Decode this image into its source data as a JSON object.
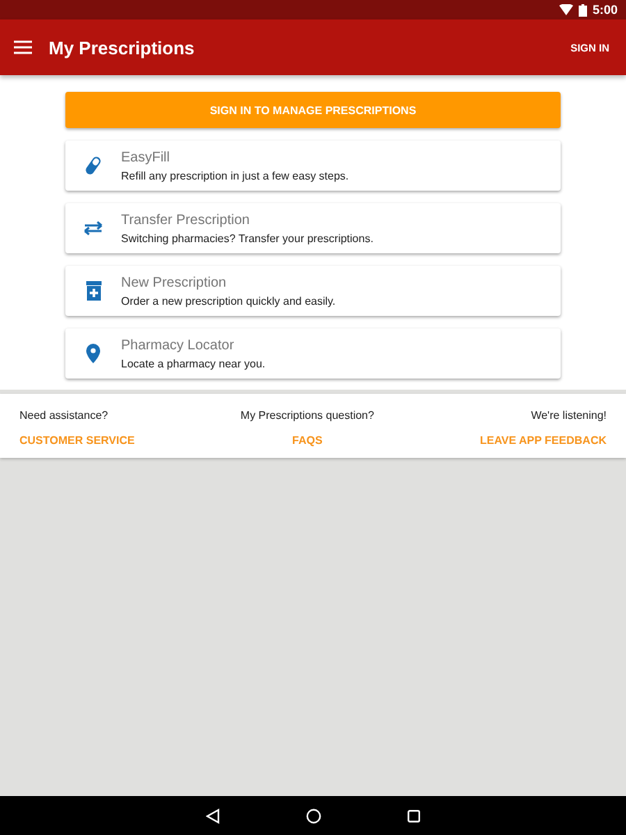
{
  "status_bar": {
    "time": "5:00"
  },
  "app_bar": {
    "title": "My Prescriptions",
    "action": "SIGN IN"
  },
  "primary_button": "SIGN IN TO MANAGE PRESCRIPTIONS",
  "cards": [
    {
      "kind": "pill",
      "title": "EasyFill",
      "subtitle": "Refill any prescription in just a few easy steps."
    },
    {
      "kind": "transfer",
      "title": "Transfer Prescription",
      "subtitle": "Switching pharmacies? Transfer your prescriptions."
    },
    {
      "kind": "bottle",
      "title": "New Prescription",
      "subtitle": "Order a new prescription quickly and easily."
    },
    {
      "kind": "pin",
      "title": "Pharmacy Locator",
      "subtitle": "Locate a pharmacy near you."
    }
  ],
  "footer": [
    {
      "prompt": "Need assistance?",
      "link": "CUSTOMER SERVICE"
    },
    {
      "prompt": "My Prescriptions question?",
      "link": "FAQS"
    },
    {
      "prompt": "We're listening!",
      "link": "LEAVE APP FEEDBACK"
    }
  ]
}
